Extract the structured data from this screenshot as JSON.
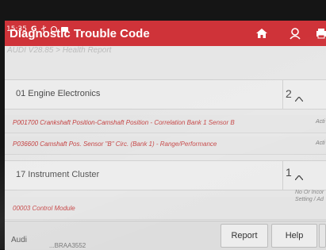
{
  "status_bar": {
    "time": "15:35",
    "icons": [
      "g-icon",
      "usb-icon",
      "target-icon",
      "video-icon"
    ]
  },
  "header": {
    "title": "Diagnostic Trouble Code",
    "icons": [
      "home-icon",
      "user-icon",
      "print-icon"
    ],
    "color": "#cf3339"
  },
  "breadcrumb": "AUDI V28.85 > Health Report",
  "groups": [
    {
      "label": "01 Engine Electronics",
      "count": "2"
    },
    {
      "label": "17 Instrument Cluster",
      "count": "1"
    }
  ],
  "codes": [
    {
      "text": "P001700 Crankshaft Position-Camshaft Position - Correlation Bank 1 Sensor B",
      "status": "Acti"
    },
    {
      "text": "P036600 Camshaft Pos. Sensor \"B\" Circ. (Bank 1) - Range/Performance",
      "status": "Acti"
    },
    {
      "text": "00003 Control Module",
      "status_line1": "No Or Incor",
      "status_line2": "Setting / Ad"
    }
  ],
  "footer": {
    "vehicle": "Audi",
    "vin": "...BRAA3552",
    "report_label": "Report",
    "help_label": "Help"
  }
}
